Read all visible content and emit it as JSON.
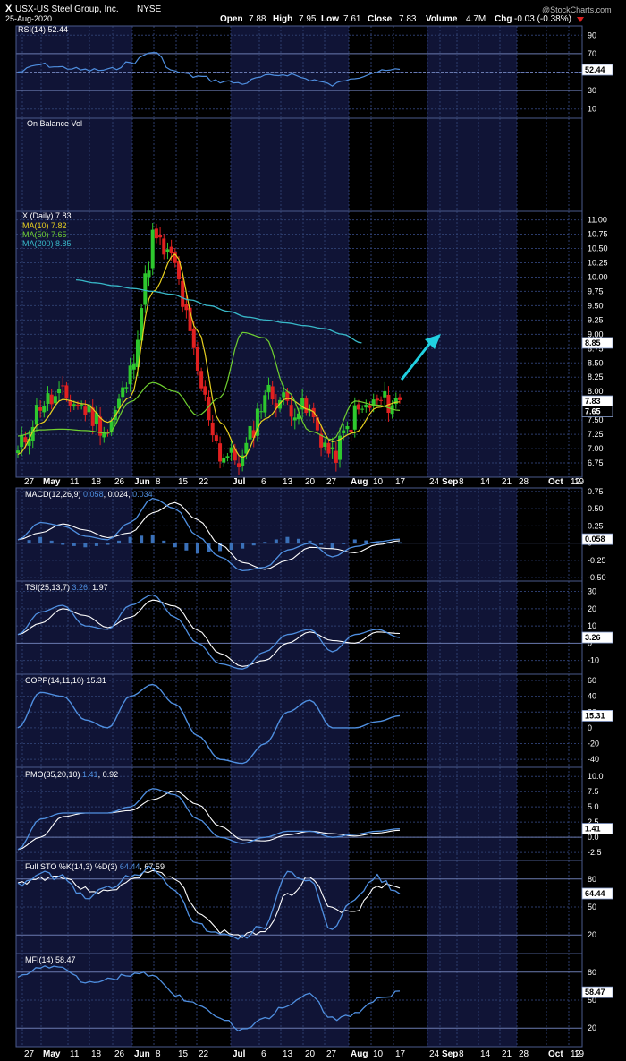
{
  "header": {
    "symbol": "X",
    "company": "USX-US Steel Group, Inc.",
    "exchange": "NYSE",
    "date": "25-Aug-2020",
    "open_label": "Open",
    "open": "7.88",
    "high_label": "High",
    "high": "7.95",
    "low_label": "Low",
    "low": "7.61",
    "close_label": "Close",
    "close": "7.83",
    "volume_label": "Volume",
    "volume": "4.7M",
    "chg_label": "Chg",
    "chg": "-0.03 (-0.38%)",
    "watermark": "@StockCharts.com"
  },
  "colors": {
    "background": "#000000",
    "panel_band": "#101436",
    "grid": "#2c3c6c",
    "border": "#4a5a8c",
    "line_blue": "#4f8fe0",
    "signal_white": "#ffffff",
    "ma10": "#e8d020",
    "ma50": "#70d030",
    "ma200": "#38b8c8",
    "up_candle": "#2ec82e",
    "down_candle": "#e02020",
    "arrow": "#20d0e0",
    "down_triangle": "#e02020"
  },
  "x_axis": {
    "labels": [
      "27",
      "May",
      "11",
      "18",
      "26",
      "Jun",
      "8",
      "15",
      "22",
      "Jul",
      "6",
      "13",
      "20",
      "27",
      "Aug",
      "10",
      "17",
      "24",
      "Sep",
      "8",
      "14",
      "21",
      "28",
      "Oct",
      "12",
      "19"
    ],
    "bold": [
      "May",
      "Jun",
      "Jul",
      "Aug",
      "Sep",
      "Oct"
    ]
  },
  "panels": {
    "rsi": {
      "label": "RSI(14) 52.44",
      "value_tag": "52.44",
      "ticks": [
        "90",
        "70",
        "50",
        "30",
        "10"
      ]
    },
    "obv": {
      "label": "On Balance Vol"
    },
    "price": {
      "label": "X (Daily) 7.83",
      "ma10": "MA(10) 7.82",
      "ma50": "MA(50) 7.65",
      "ma200": "MA(200) 8.85",
      "ticks": [
        "11.00",
        "10.75",
        "10.50",
        "10.25",
        "10.00",
        "9.75",
        "9.50",
        "9.25",
        "9.00",
        "8.75",
        "8.50",
        "8.25",
        "8.00",
        "7.75",
        "7.50",
        "7.25",
        "7.00",
        "6.75"
      ],
      "tags": [
        "8.85",
        "7.83",
        "7.65"
      ]
    },
    "macd": {
      "label_prefix": "MACD(12,26,9)",
      "v1": "0.058",
      "v2": "0.024",
      "v3": "0.034",
      "value_tag": "0.058",
      "ticks": [
        "0.75",
        "0.50",
        "0.25",
        "-0.25",
        "-0.50"
      ]
    },
    "tsi": {
      "label_prefix": "TSI(25,13,7)",
      "v1": "3.26",
      "v2": "1.97",
      "value_tag": "3.26",
      "ticks": [
        "30",
        "20",
        "10",
        "-10"
      ]
    },
    "copp": {
      "label": "COPP(14,11,10) 15.31",
      "value_tag": "15.31",
      "ticks": [
        "60",
        "40",
        "20",
        "0",
        "-20",
        "-40"
      ]
    },
    "pmo": {
      "label_prefix": "PMO(35,20,10)",
      "v1": "1.41",
      "v2": "0.92",
      "value_tag": "1.41",
      "ticks": [
        "10.0",
        "7.5",
        "5.0",
        "2.5",
        "0.0",
        "-2.5"
      ]
    },
    "sto": {
      "label_prefix": "Full STO %K(14,3) %D(3)",
      "v1": "64.44",
      "v2": "67.59",
      "value_tag": "64.44",
      "ticks": [
        "80",
        "50",
        "20"
      ]
    },
    "mfi": {
      "label": "MFI(14) 58.47",
      "value_tag": "58.47",
      "ticks": [
        "80",
        "50",
        "20"
      ]
    }
  },
  "chart_data": {
    "type": "line",
    "title": "USX-US Steel Group, Inc. NYSE",
    "x": [
      "27",
      "May",
      "11",
      "18",
      "26",
      "Jun",
      "8",
      "15",
      "22",
      "Jul",
      "6",
      "13",
      "20",
      "27",
      "Aug",
      "10",
      "17",
      "24"
    ],
    "price_close": [
      6.9,
      7.8,
      7.9,
      7.7,
      7.3,
      8.3,
      10.7,
      10.2,
      8.3,
      6.9,
      6.8,
      8.0,
      7.8,
      7.6,
      6.8,
      7.6,
      7.8,
      7.83
    ],
    "ma200": [
      10.2,
      10.05,
      9.95,
      9.9,
      9.85,
      9.8,
      9.75,
      9.7,
      9.6,
      9.5,
      9.4,
      9.3,
      9.25,
      9.2,
      9.15,
      9.1,
      9.0,
      8.85
    ],
    "rsi": [
      50,
      58,
      55,
      52,
      52,
      60,
      72,
      50,
      45,
      40,
      38,
      45,
      48,
      42,
      36,
      45,
      50,
      52.44
    ],
    "macd_line": [
      0.05,
      0.3,
      0.25,
      0.1,
      0.05,
      0.3,
      0.65,
      0.5,
      0.1,
      -0.2,
      -0.4,
      -0.35,
      -0.1,
      0.0,
      -0.2,
      -0.05,
      0.02,
      0.058
    ],
    "tsi": [
      5,
      18,
      22,
      10,
      8,
      22,
      28,
      15,
      0,
      -12,
      -15,
      -5,
      5,
      8,
      -5,
      5,
      8,
      3.26
    ],
    "copp": [
      0,
      45,
      40,
      10,
      0,
      40,
      55,
      30,
      -10,
      -40,
      -45,
      -20,
      20,
      35,
      0,
      0,
      8,
      15.31
    ],
    "pmo": [
      -2,
      3,
      4,
      4,
      4,
      5,
      8,
      7,
      3,
      0,
      -1,
      0,
      1,
      1,
      0,
      0.5,
      1,
      1.41
    ],
    "sto_k": [
      75,
      85,
      82,
      60,
      70,
      85,
      92,
      70,
      30,
      20,
      18,
      30,
      85,
      80,
      25,
      60,
      82,
      64.44
    ],
    "mfi": [
      75,
      85,
      85,
      70,
      72,
      78,
      78,
      55,
      45,
      30,
      18,
      30,
      45,
      55,
      30,
      35,
      50,
      58.47
    ]
  }
}
